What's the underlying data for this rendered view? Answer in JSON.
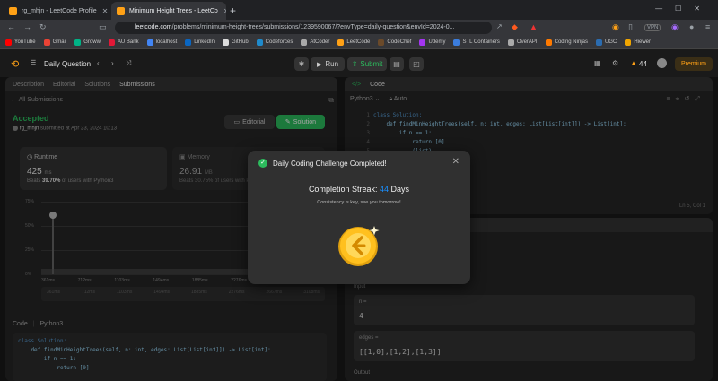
{
  "browser": {
    "tabs": [
      {
        "label": "rg_mhjn - LeetCode Profile"
      },
      {
        "label": "Minimum Height Trees - LeetCo"
      }
    ],
    "url_domain": "leetcode.com",
    "url_path": "/problems/minimum-height-trees/submissions/1239590067/?envType=daily-question&envId=2024-0...",
    "vpn_label": "VPN",
    "bookmarks": [
      "YouTube",
      "Gmail",
      "Groww",
      "AU Bank",
      "localhost",
      "LinkedIn",
      "GitHub",
      "Codeforces",
      "AtCoder",
      "LeetCode",
      "CodeChef",
      "Udemy",
      "STL Containers",
      "OverAPI",
      "Coding Ninjas",
      "UGC",
      "Hiewer"
    ]
  },
  "lc_nav": {
    "list_label": "Daily Question",
    "run_label": "Run",
    "submit_label": "Submit",
    "streak_count": "44",
    "premium_label": "Premium"
  },
  "left_pane": {
    "tabs": [
      "Description",
      "Editorial",
      "Solutions",
      "Submissions"
    ],
    "back_label": "All Submissions",
    "status": "Accepted",
    "user": "rg_mhjn",
    "submitted_text": "submitted at Apr 23, 2024 10:13",
    "editorial_btn": "Editorial",
    "solution_btn": "Solution",
    "runtime_label": "Runtime",
    "runtime_value": "425",
    "runtime_unit": "ms",
    "beats_prefix": "Beats",
    "beats_value": "39.70%",
    "beats_suffix": "of users with Python3",
    "memory_label": "Memory",
    "memory_value": "26.91",
    "memory_unit": "MB",
    "memory_beats_prefix": "Beats",
    "memory_beats_value": "30.75%",
    "memory_beats_suffix": "of users with Python3",
    "chart_yticks": [
      "75%",
      "50%",
      "25%",
      "0%"
    ],
    "chart_xticks": [
      "361ms",
      "712ms",
      "1103ms",
      "1494ms",
      "1885ms",
      "2276ms",
      "2667ms",
      "3108ms"
    ],
    "chart_sub_ticks": [
      "361ms",
      "712ms",
      "1103ms",
      "1494ms",
      "1885ms",
      "2276ms",
      "2667ms",
      "3108ms"
    ],
    "code_tab": "Code",
    "code_lang": "Python3",
    "code_lines": [
      "class Solution:",
      "    def findMinHeightTrees(self, n: int, edges: List[List[int]]) -> List[int]:",
      "        if n == 1:",
      "            return [0]"
    ]
  },
  "right_pane": {
    "code_header": "Code",
    "lang": "Python3",
    "auto": "Auto",
    "code_lines": [
      "class Solution:",
      "    def findMinHeightTrees(self, n: int, edges: List[List[int]]) -> List[int]:",
      "        if n == 1:",
      "            return [0]",
      "",
      "",
      "            (list)",
      "",
      "            (n)",
      "            (n)"
    ],
    "line_numbers": [
      "1",
      "2",
      "3",
      "4",
      "5",
      "6",
      "7",
      "8",
      "9",
      "10"
    ],
    "cursor_pos": "Ln 5, Col 1",
    "input_label": "Input",
    "n_label": "n =",
    "n_value": "4",
    "edges_label": "edges =",
    "edges_value": "[[1,0],[1,2],[1,3]]",
    "output_label": "Output"
  },
  "modal": {
    "title": "Daily Coding Challenge Completed!",
    "streak_prefix": "Completion Streak:",
    "streak_value": "44",
    "streak_suffix": "Days",
    "subtitle": "Consistency is key, see you tomorrow!"
  },
  "colors": {
    "accent_green": "#2cbb5d",
    "streak_blue": "#1a90ff",
    "orange": "#ffa116",
    "coin": "#ffc01e"
  }
}
